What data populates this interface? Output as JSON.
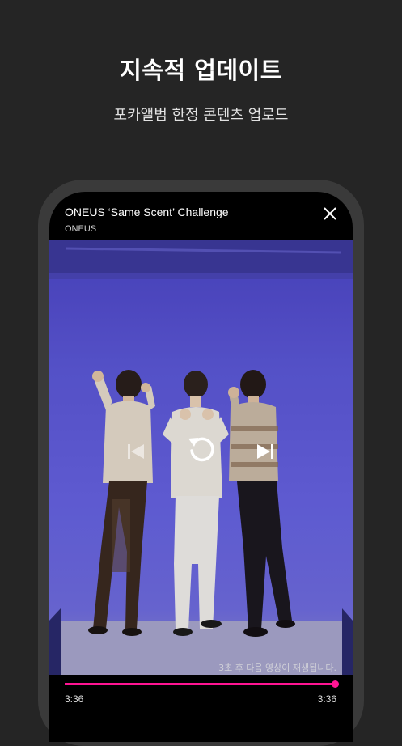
{
  "promo": {
    "headline": "지속적 업데이트",
    "subheadline": "포카앨범 한정 콘텐츠 업로드"
  },
  "player": {
    "title": "ONEUS ‘Same Scent’ Challenge",
    "artist": "ONEUS",
    "autoplay_notice": "3초 후 다음 영상이 재생됩니다.",
    "current_time": "3:36",
    "total_time": "3:36",
    "progress": 1.0,
    "controls": {
      "close_icon": "close-icon",
      "prev_icon": "skip-previous-icon",
      "replay_icon": "replay-icon",
      "next_icon": "skip-next-icon"
    },
    "colors": {
      "accent": "#ff1493",
      "backdrop": "#5c58d8"
    }
  }
}
